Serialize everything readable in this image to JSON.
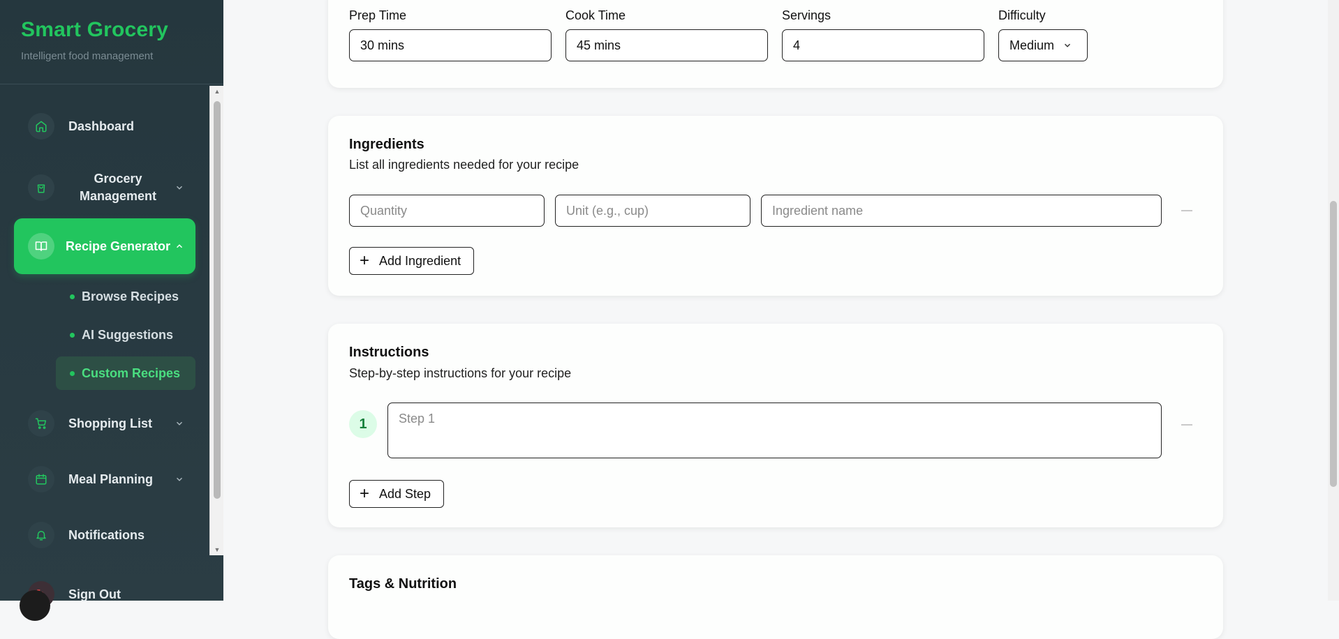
{
  "brand": {
    "title": "Smart Grocery",
    "subtitle": "Intelligent food management"
  },
  "sidebar": {
    "items": [
      {
        "label": "Dashboard",
        "icon": "home-icon"
      },
      {
        "label": "Grocery Management",
        "icon": "shopping-bag-icon"
      },
      {
        "label": "Recipe Generator",
        "icon": "book-icon"
      },
      {
        "label": "Shopping List",
        "icon": "cart-icon"
      },
      {
        "label": "Meal Planning",
        "icon": "calendar-icon"
      },
      {
        "label": "Notifications",
        "icon": "bell-icon"
      }
    ],
    "sub_items": [
      {
        "label": "Browse Recipes"
      },
      {
        "label": "AI Suggestions"
      },
      {
        "label": "Custom Recipes"
      }
    ],
    "signout": "Sign Out"
  },
  "colors": {
    "accent": "#22c55e",
    "sidebar_bg": "#25373e",
    "step_badge_bg": "#dcfce7"
  },
  "details": {
    "prep_time": {
      "label": "Prep Time",
      "value": "30 mins"
    },
    "cook_time": {
      "label": "Cook Time",
      "value": "45 mins"
    },
    "servings": {
      "label": "Servings",
      "value": "4"
    },
    "difficulty": {
      "label": "Difficulty",
      "value": "Medium"
    }
  },
  "ingredients": {
    "title": "Ingredients",
    "subtitle": "List all ingredients needed for your recipe",
    "quantity_placeholder": "Quantity",
    "unit_placeholder": "Unit (e.g., cup)",
    "name_placeholder": "Ingredient name",
    "add_label": "Add Ingredient"
  },
  "instructions": {
    "title": "Instructions",
    "subtitle": "Step-by-step instructions for your recipe",
    "step_number": "1",
    "step_placeholder": "Step 1",
    "add_label": "Add Step"
  },
  "tags": {
    "title": "Tags & Nutrition"
  }
}
